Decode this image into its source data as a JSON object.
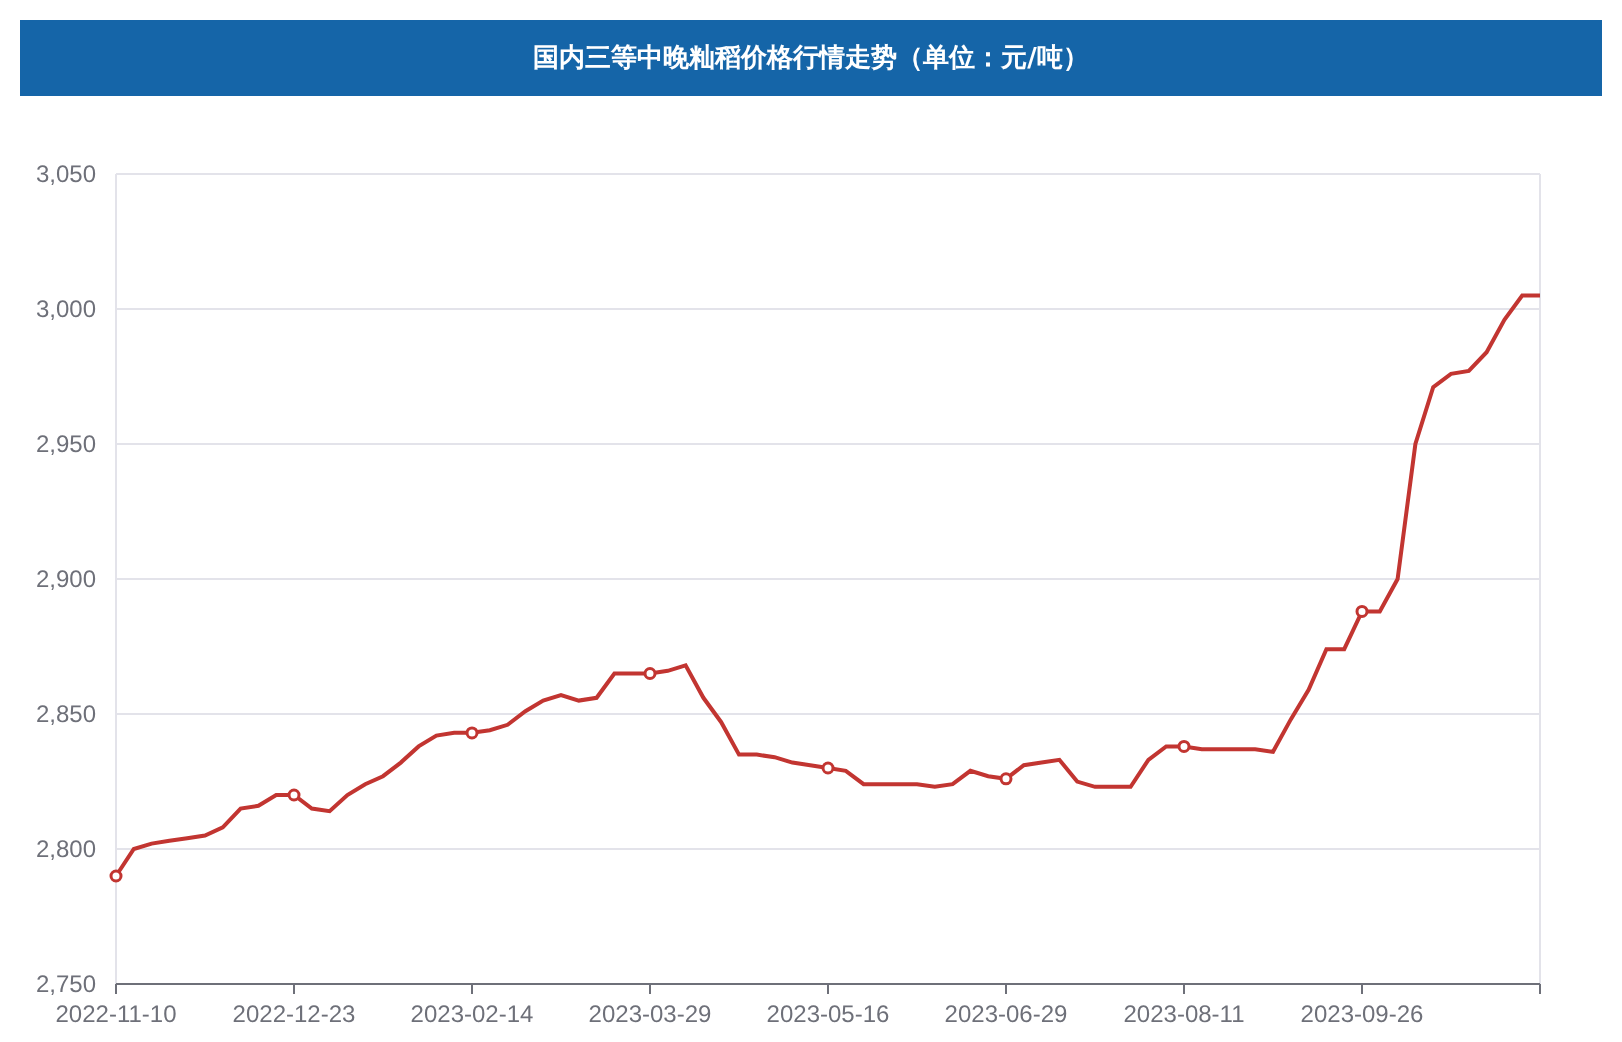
{
  "title": "国内三等中晚籼稻价格行情走势（单位：元/吨）",
  "chart_data": {
    "type": "line",
    "categories": [
      "2022-11-10",
      null,
      null,
      null,
      null,
      null,
      null,
      null,
      null,
      null,
      "2022-12-23",
      null,
      null,
      null,
      null,
      null,
      null,
      null,
      null,
      null,
      "2023-02-14",
      null,
      null,
      null,
      null,
      null,
      null,
      null,
      null,
      null,
      "2023-03-29",
      null,
      null,
      null,
      null,
      null,
      null,
      null,
      null,
      null,
      "2023-05-16",
      null,
      null,
      null,
      null,
      null,
      null,
      null,
      null,
      null,
      "2023-06-29",
      null,
      null,
      null,
      null,
      null,
      null,
      null,
      null,
      null,
      "2023-08-11",
      null,
      null,
      null,
      null,
      null,
      null,
      null,
      null,
      null,
      "2023-09-26",
      null,
      null,
      null,
      null,
      null,
      null,
      null,
      null,
      null,
      null
    ],
    "series": [
      {
        "color": "#c23531",
        "values": [
          2790,
          2800,
          2802,
          2803,
          2804,
          2805,
          2808,
          2815,
          2816,
          2820,
          2820,
          2815,
          2814,
          2820,
          2824,
          2827,
          2832,
          2838,
          2842,
          2843,
          2843,
          2844,
          2846,
          2851,
          2855,
          2857,
          2855,
          2856,
          2865,
          2865,
          2865,
          2866,
          2868,
          2856,
          2847,
          2835,
          2835,
          2834,
          2832,
          2831,
          2830,
          2829,
          2824,
          2824,
          2824,
          2824,
          2823,
          2824,
          2829,
          2827,
          2826,
          2831,
          2832,
          2833,
          2825,
          2823,
          2823,
          2823,
          2833,
          2838,
          2838,
          2837,
          2837,
          2837,
          2837,
          2836,
          2848,
          2859,
          2874,
          2874,
          2888,
          2888,
          2900,
          2950,
          2971,
          2976,
          2977,
          2984,
          2996,
          3005,
          3005
        ]
      }
    ],
    "ylim": [
      2750,
      3050
    ],
    "grid": true,
    "yticks": [
      {
        "value": 2750,
        "label": "2,750"
      },
      {
        "value": 2800,
        "label": "2,800"
      },
      {
        "value": 2850,
        "label": "2,850"
      },
      {
        "value": 2900,
        "label": "2,900"
      },
      {
        "value": 2950,
        "label": "2,950"
      },
      {
        "value": 3000,
        "label": "3,000"
      },
      {
        "value": 3050,
        "label": "3,050"
      }
    ]
  }
}
